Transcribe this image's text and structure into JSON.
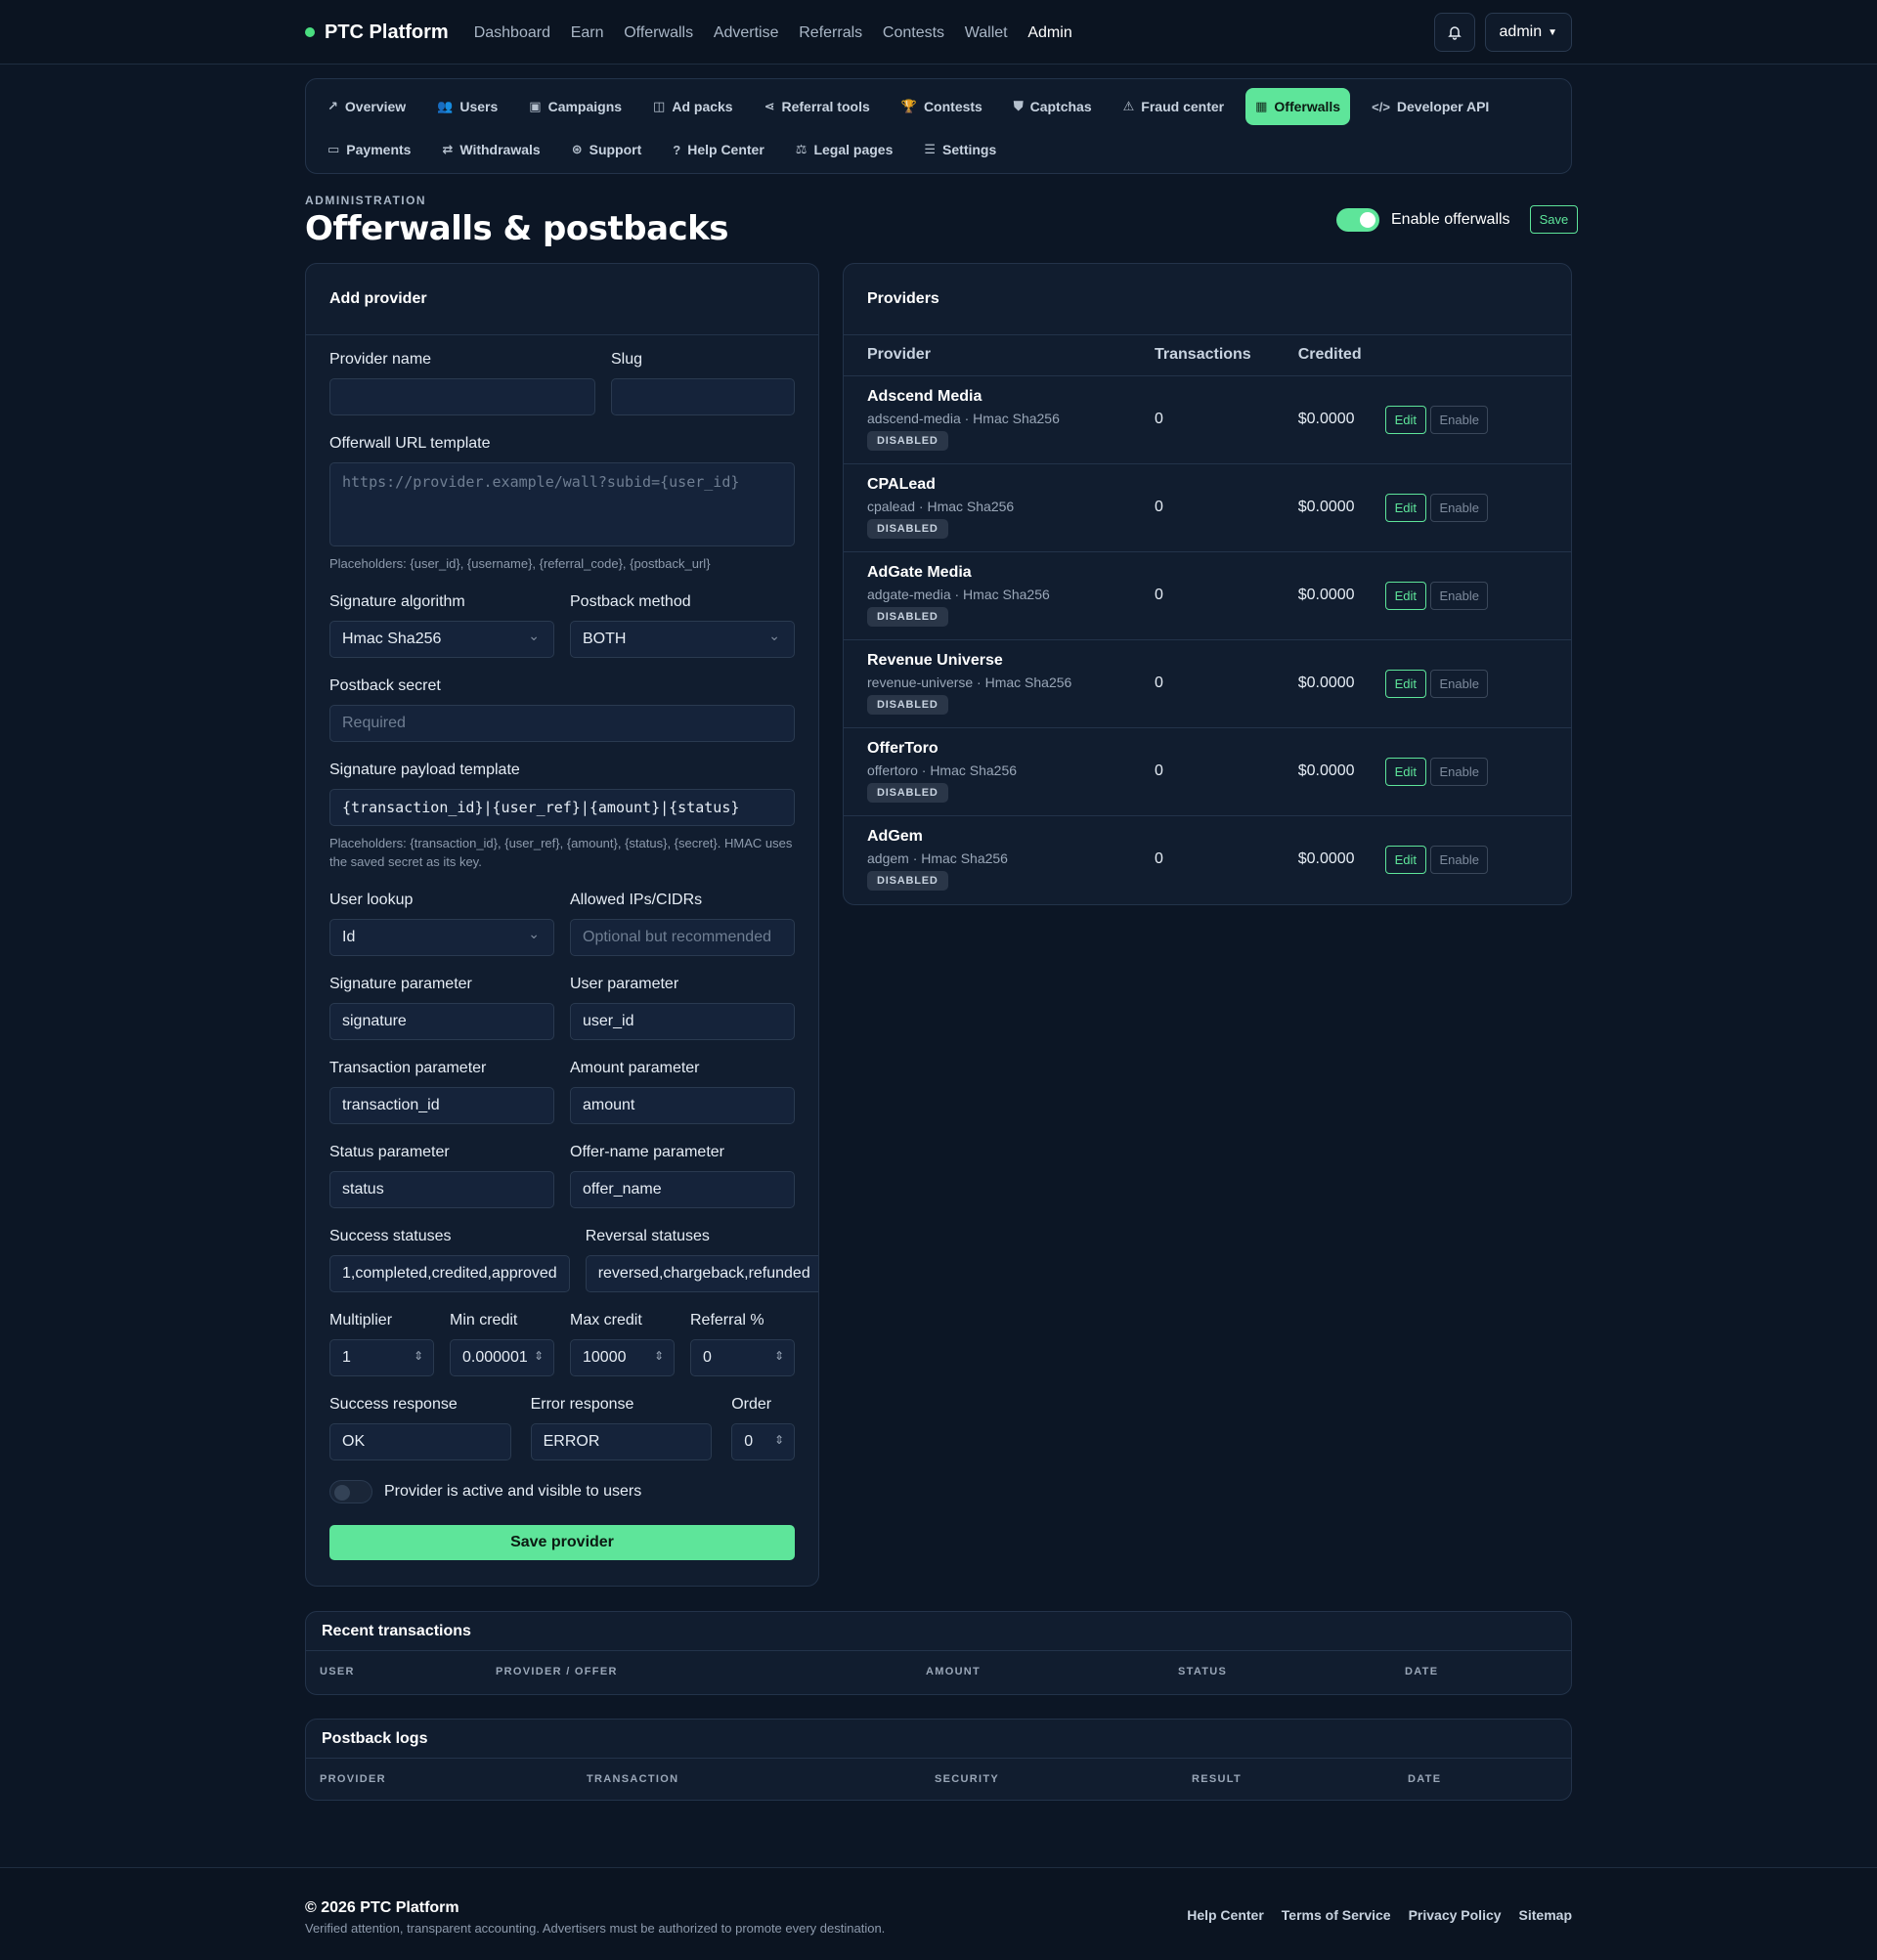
{
  "brand": {
    "name": "PTC Platform"
  },
  "topnav": [
    "Dashboard",
    "Earn",
    "Offerwalls",
    "Advertise",
    "Referrals",
    "Contests",
    "Wallet",
    "Admin"
  ],
  "user": {
    "name": "admin"
  },
  "subnav_row1": [
    {
      "label": "Overview",
      "icon": "↗"
    },
    {
      "label": "Users",
      "icon": "👥"
    },
    {
      "label": "Campaigns",
      "icon": "▣"
    },
    {
      "label": "Ad packs",
      "icon": "◫"
    },
    {
      "label": "Referral tools",
      "icon": "⋖"
    },
    {
      "label": "Contests",
      "icon": "🏆"
    },
    {
      "label": "Captchas",
      "icon": "⛊"
    },
    {
      "label": "Fraud center",
      "icon": "⚠"
    },
    {
      "label": "Offerwalls",
      "icon": "▦"
    },
    {
      "label": "Developer API",
      "icon": "</>"
    }
  ],
  "subnav_row2": [
    {
      "label": "Payments",
      "icon": "▭"
    },
    {
      "label": "Withdrawals",
      "icon": "⇄"
    },
    {
      "label": "Support",
      "icon": "⊛"
    },
    {
      "label": "Help Center",
      "icon": "?"
    },
    {
      "label": "Legal pages",
      "icon": "⚖"
    },
    {
      "label": "Settings",
      "icon": "☰"
    }
  ],
  "page": {
    "eyebrow": "ADMINISTRATION",
    "title": "Offerwalls & postbacks",
    "toggle_label": "Enable offerwalls",
    "save": "Save"
  },
  "form": {
    "title": "Add provider",
    "provider_name_label": "Provider name",
    "slug_label": "Slug",
    "url_label": "Offerwall URL template",
    "url_placeholder": "https://provider.example/wall?subid={user_id}",
    "url_hint": "Placeholders: {user_id}, {username}, {referral_code}, {postback_url}",
    "sig_algo_label": "Signature algorithm",
    "sig_algo_value": "Hmac Sha256",
    "postback_method_label": "Postback method",
    "postback_method_value": "BOTH",
    "secret_label": "Postback secret",
    "secret_placeholder": "Required",
    "payload_label": "Signature payload template",
    "payload_value": "{transaction_id}|{user_ref}|{amount}|{status}",
    "payload_hint": "Placeholders: {transaction_id}, {user_ref}, {amount}, {status}, {secret}. HMAC uses the saved secret as its key.",
    "lookup_label": "User lookup",
    "lookup_value": "Id",
    "ips_label": "Allowed IPs/CIDRs",
    "ips_placeholder": "Optional but recommended",
    "sig_param_label": "Signature parameter",
    "sig_param_value": "signature",
    "user_param_label": "User parameter",
    "user_param_value": "user_id",
    "tx_param_label": "Transaction parameter",
    "tx_param_value": "transaction_id",
    "amount_param_label": "Amount parameter",
    "amount_param_value": "amount",
    "status_param_label": "Status parameter",
    "status_param_value": "status",
    "offer_param_label": "Offer-name parameter",
    "offer_param_value": "offer_name",
    "success_statuses_label": "Success statuses",
    "success_statuses_value": "1,completed,credited,approved",
    "reversal_statuses_label": "Reversal statuses",
    "reversal_statuses_value": "reversed,chargeback,refunded",
    "multiplier_label": "Multiplier",
    "multiplier_value": "1",
    "min_credit_label": "Min credit",
    "min_credit_value": "0.000001",
    "max_credit_label": "Max credit",
    "max_credit_value": "10000",
    "referral_label": "Referral %",
    "referral_value": "0",
    "success_response_label": "Success response",
    "success_response_value": "OK",
    "error_response_label": "Error response",
    "error_response_value": "ERROR",
    "order_label": "Order",
    "order_value": "0",
    "active_label": "Provider is active and visible to users",
    "submit": "Save provider"
  },
  "providers": {
    "title": "Providers",
    "columns": [
      "Provider",
      "Transactions",
      "Credited"
    ],
    "edit_label": "Edit",
    "enable_label": "Enable",
    "rows": [
      {
        "name": "Adscend Media",
        "meta": "adscend-media · Hmac Sha256",
        "status": "DISABLED",
        "transactions": "0",
        "credited": "$0.0000"
      },
      {
        "name": "CPALead",
        "meta": "cpalead · Hmac Sha256",
        "status": "DISABLED",
        "transactions": "0",
        "credited": "$0.0000"
      },
      {
        "name": "AdGate Media",
        "meta": "adgate-media · Hmac Sha256",
        "status": "DISABLED",
        "transactions": "0",
        "credited": "$0.0000"
      },
      {
        "name": "Revenue Universe",
        "meta": "revenue-universe · Hmac Sha256",
        "status": "DISABLED",
        "transactions": "0",
        "credited": "$0.0000"
      },
      {
        "name": "OfferToro",
        "meta": "offertoro · Hmac Sha256",
        "status": "DISABLED",
        "transactions": "0",
        "credited": "$0.0000"
      },
      {
        "name": "AdGem",
        "meta": "adgem · Hmac Sha256",
        "status": "DISABLED",
        "transactions": "0",
        "credited": "$0.0000"
      }
    ]
  },
  "transactions": {
    "title": "Recent transactions",
    "columns": [
      "USER",
      "PROVIDER / OFFER",
      "AMOUNT",
      "STATUS",
      "DATE"
    ]
  },
  "logs": {
    "title": "Postback logs",
    "columns": [
      "PROVIDER",
      "TRANSACTION",
      "SECURITY",
      "RESULT",
      "DATE"
    ]
  },
  "footer": {
    "copy": "© 2026 PTC Platform",
    "tagline": "Verified attention, transparent accounting. Advertisers must be authorized to promote every destination.",
    "links": [
      "Help Center",
      "Terms of Service",
      "Privacy Policy",
      "Sitemap"
    ]
  }
}
